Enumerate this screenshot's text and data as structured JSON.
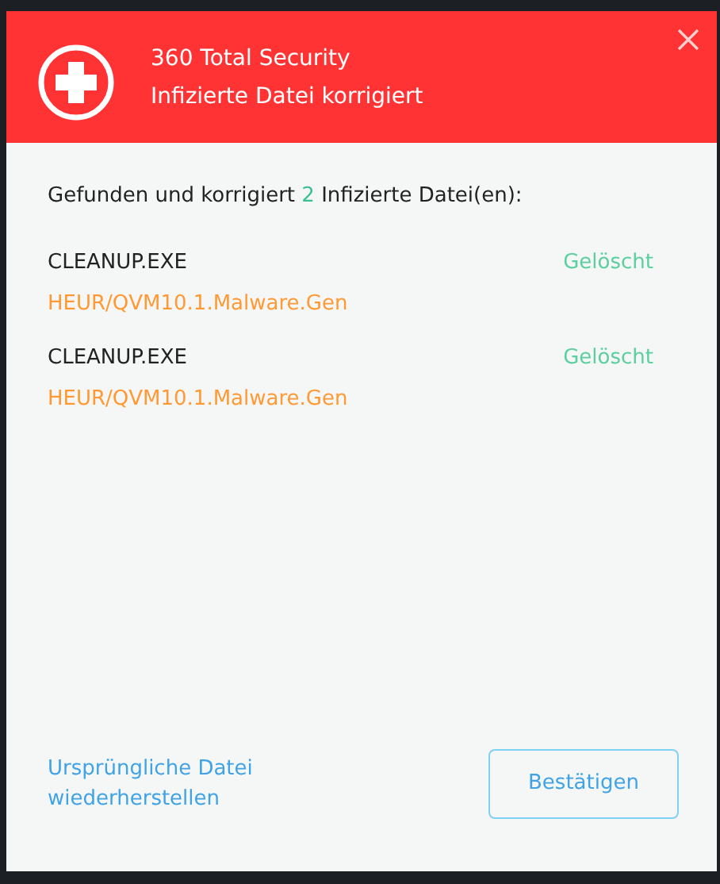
{
  "window": {
    "app_name": "360 Total Security",
    "title": "Infizierte Datei korrigiert"
  },
  "summary": {
    "prefix": "Gefunden und korrigiert",
    "count": "2",
    "suffix": "Infizierte Datei(en):"
  },
  "files": [
    {
      "name": "CLEANUP.EXE",
      "threat": "HEUR/QVM10.1.Malware.Gen",
      "status": "Gelöscht"
    },
    {
      "name": "CLEANUP.EXE",
      "threat": "HEUR/QVM10.1.Malware.Gen",
      "status": "Gelöscht"
    }
  ],
  "restore_link": "Ursprüngliche Datei wiederherstellen",
  "confirm_button": "Bestätigen"
}
